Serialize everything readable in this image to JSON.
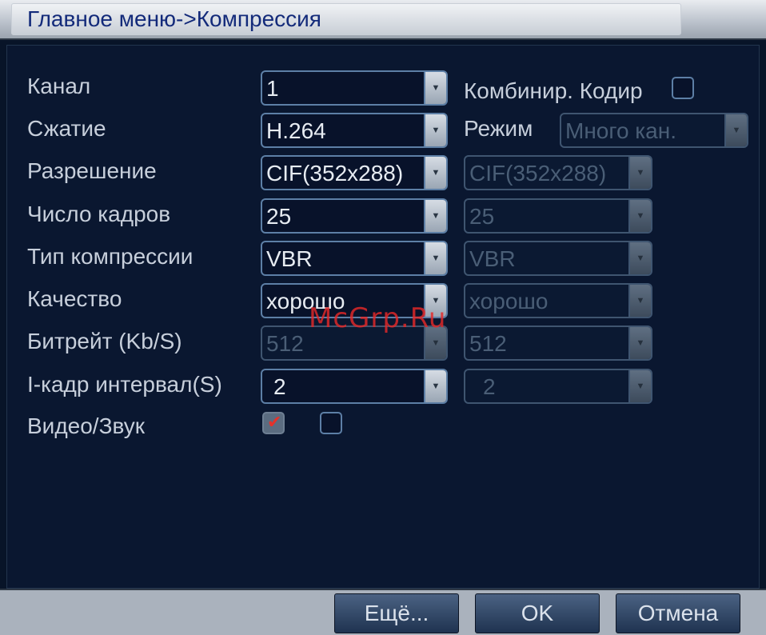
{
  "title": "Главное меню->Компрессия",
  "fields": {
    "channel": {
      "label": "Канал",
      "value": "1"
    },
    "compression": {
      "label": "Сжатие",
      "value": "H.264"
    },
    "resolution": {
      "label": "Разрешение",
      "main": "CIF(352x288)",
      "extra": "CIF(352x288)"
    },
    "framerate": {
      "label": "Число кадров",
      "main": "25",
      "extra": "25"
    },
    "bitrate_type": {
      "label": "Тип компрессии",
      "main": "VBR",
      "extra": "VBR"
    },
    "quality": {
      "label": "Качество",
      "main": "хорошо",
      "extra": "хорошо"
    },
    "bitrate": {
      "label": "Битрейт (Kb/S)",
      "main": "512",
      "extra": "512"
    },
    "iframe_interval": {
      "label": "I-кадр интервал(S)",
      "main": "2",
      "extra": "2"
    },
    "video_audio": {
      "label": "Видео/Звук",
      "main_checked": true,
      "extra_checked": false
    }
  },
  "combined_encoding": {
    "label": "Комбинир. Кодир",
    "checked": false
  },
  "mode": {
    "label": "Режим",
    "value": "Много кан."
  },
  "watermark": "McGrp.Ru",
  "buttons": {
    "more": "Ещё...",
    "ok": "OK",
    "cancel": "Отмена"
  },
  "colors": {
    "background": "#0a1730",
    "accent": "#5d7fa6",
    "title_text": "#132a7a",
    "watermark": "#e52828"
  }
}
